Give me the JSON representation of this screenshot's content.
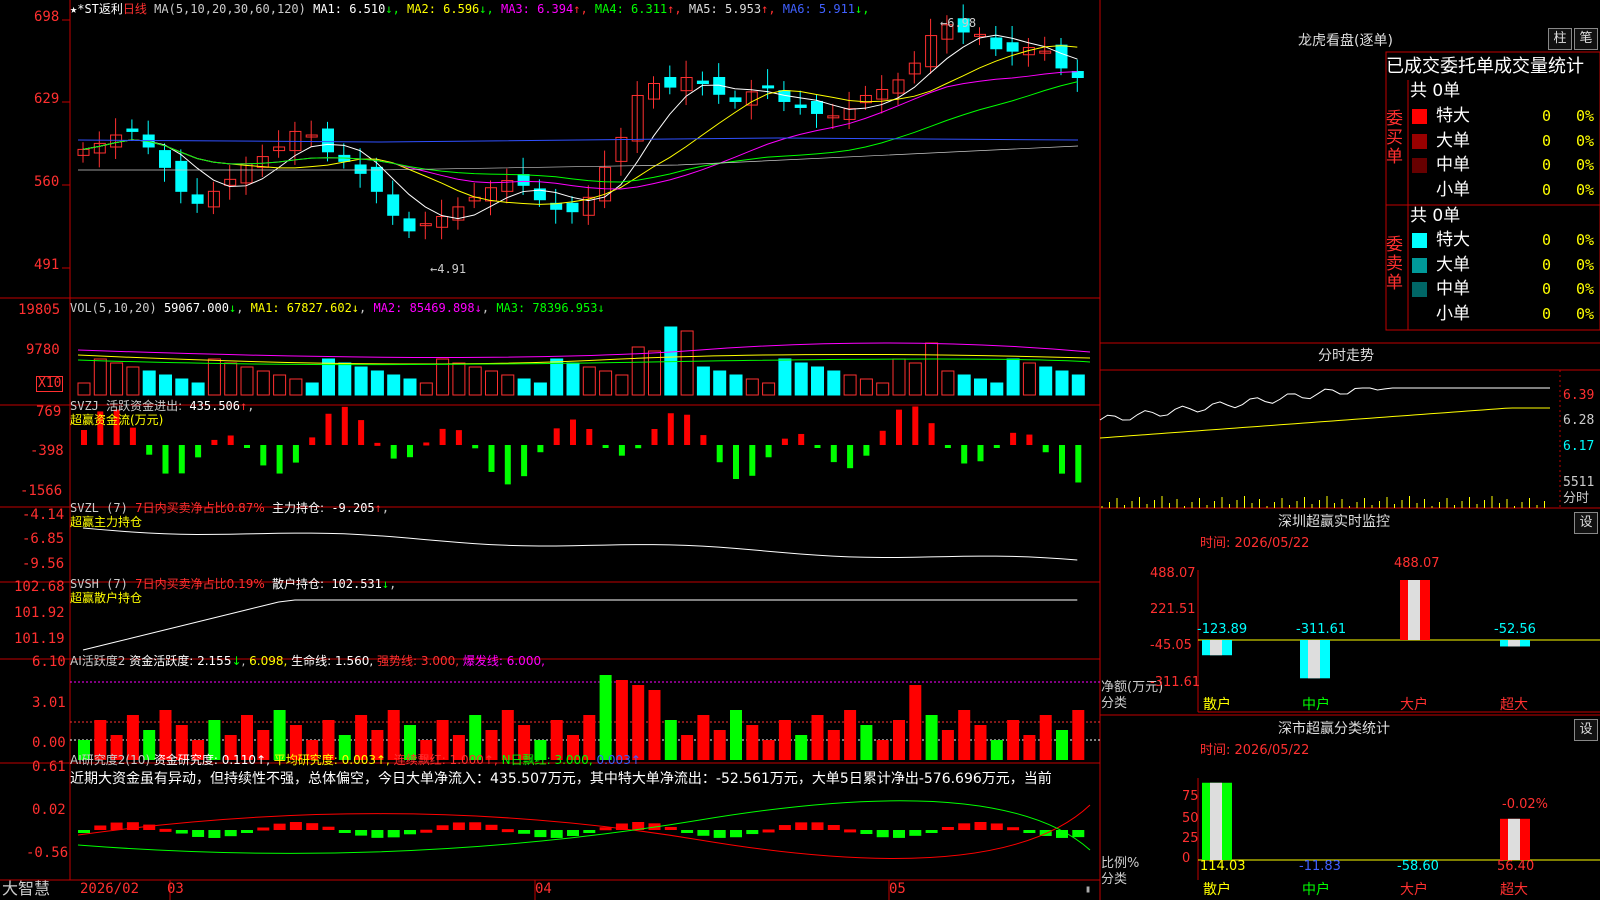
{
  "header": {
    "stock_name": "★*ST返利",
    "period": "日线",
    "ma_label": "MA(5,10,20,30,60,120)",
    "ma_values": [
      {
        "label": "MA1:",
        "value": "6.510",
        "arrow": "↓",
        "color": "#ffffff"
      },
      {
        "label": "MA2:",
        "value": "6.596",
        "arrow": "↓",
        "color": "#ffff00"
      },
      {
        "label": "MA3:",
        "value": "6.394",
        "arrow": "↑",
        "color": "#ff00ff"
      },
      {
        "label": "MA4:",
        "value": "6.311",
        "arrow": "↑",
        "color": "#00ff00"
      },
      {
        "label": "MA5:",
        "value": "5.953",
        "arrow": "↑",
        "color": "#dddddd"
      },
      {
        "label": "MA6:",
        "value": "5.911",
        "arrow": "↓",
        "color": "#4060ff"
      }
    ]
  },
  "price_panel": {
    "y_labels": [
      "698",
      "629",
      "560",
      "491"
    ],
    "high_note": "6.98",
    "low_note": "4.91"
  },
  "vol_panel": {
    "label": "VOL(5,10,20)",
    "vol_value": "59067.000",
    "vol_arrow": "↓",
    "ma1": "MA1: 67827.602↓",
    "ma2": "MA2: 85469.898↓",
    "ma3": "MA3: 78396.953↓",
    "y_labels": [
      "19805",
      "9780"
    ],
    "unit": "X10"
  },
  "svzj_panel": {
    "label": "SVZJ",
    "title": "活跃资金进出:",
    "value": "435.506",
    "arrow": "↑",
    "subtitle": "超赢资金流(万元)",
    "y_labels": [
      "769",
      "-398",
      "-1566"
    ]
  },
  "svzl_panel": {
    "label": "SVZL (7)",
    "ratio": "7日内买卖净占比0.87%",
    "main_label": "主力持仓:",
    "main_value": "-9.205",
    "arrow": "↑",
    "subtitle": "超赢主力持仓",
    "y_labels": [
      "-4.14",
      "-6.85",
      "-9.56"
    ]
  },
  "svsh_panel": {
    "label": "SVSH (7)",
    "ratio": "7日内买卖净占比0.19%",
    "retail_label": "散户持仓:",
    "retail_value": "102.531",
    "arrow": "↓",
    "subtitle": "超赢散户持仓",
    "y_labels": [
      "102.68",
      "101.92",
      "101.19"
    ]
  },
  "ai_active_panel": {
    "label": "AI活跃度2",
    "fund_label": "资金活跃度:",
    "fund_value": "2.155",
    "fund_arrow": "↓",
    "second": "6.098,",
    "life_line": "生命线: 1.560,",
    "strong_line": "强势线: 3.000,",
    "burst_line": "爆发线: 6.000,",
    "y_labels": [
      "6.10",
      "3.01",
      "0.00"
    ]
  },
  "ai_research_panel": {
    "label": "AI研究度2(10)",
    "fund_research": "资金研究度: 0.110↑,",
    "avg_research": "平均研究度: 0.003↑,",
    "cont_red": "连续飘红: 1.000↑,",
    "n_red": "N日飘红: 3.000,",
    "last": "0.003↑",
    "comment": "近期大资金虽有异动，但持续性不强，总体偏空，今日大单净流入：435.507万元，其中特大单净流出：-52.561万元，大单5日累计净出-576.696万元，当前",
    "y_labels": [
      "0.61",
      "0.02",
      "-0.56"
    ]
  },
  "bottom_bar": {
    "brand": "大智慧",
    "dates": [
      "2026/02",
      "03",
      "04",
      "05"
    ]
  },
  "dragon_tiger": {
    "title": "龙虎看盘(逐单)",
    "tab_column": "柱",
    "tab_stroke": "笔",
    "table_title": "已成交委托单成交量统计",
    "buy_side": "委买单",
    "sell_side": "委卖单",
    "buy_total": "共 0单",
    "sell_total": "共 0单",
    "buy_rows": [
      {
        "name": "特大",
        "count": "0",
        "pct": "0%",
        "color": "#ff0000"
      },
      {
        "name": "大单",
        "count": "0",
        "pct": "0%",
        "color": "#990000"
      },
      {
        "name": "中单",
        "count": "0",
        "pct": "0%",
        "color": "#660000"
      },
      {
        "name": "小单",
        "count": "0",
        "pct": "0%",
        "color": ""
      }
    ],
    "sell_rows": [
      {
        "name": "特大",
        "count": "0",
        "pct": "0%",
        "color": "#00ffff"
      },
      {
        "name": "大单",
        "count": "0",
        "pct": "0%",
        "color": "#009999"
      },
      {
        "name": "中单",
        "count": "0",
        "pct": "0%",
        "color": "#006666"
      },
      {
        "name": "小单",
        "count": "0",
        "pct": "0%",
        "color": ""
      }
    ]
  },
  "intraday": {
    "title": "分时走势",
    "y_labels": [
      "6.39",
      "6.28",
      "6.17"
    ],
    "volume": "5511",
    "vol_unit": "分时"
  },
  "sz_monitor": {
    "title": "深圳超赢实时监控",
    "settings": "设",
    "time": "时间: 2026/05/22",
    "y_labels": [
      "488.07",
      "221.51",
      "-45.05",
      "-311.61"
    ],
    "bar_values": [
      "-123.89",
      "-311.61",
      "488.07",
      "-52.56"
    ],
    "categories": [
      "散户",
      "中户",
      "大户",
      "超大"
    ],
    "axis_caption_1": "净额(万元)",
    "axis_caption_2": "分类"
  },
  "sz_class": {
    "title": "深市超赢分类统计",
    "settings": "设",
    "time": "时间: 2026/05/22",
    "y_labels": [
      "75",
      "50",
      "25",
      "0"
    ],
    "top_value": "-0.02%",
    "bar_values": [
      "114.03",
      "-11.83",
      "-58.60",
      "56.40"
    ],
    "categories": [
      "散户",
      "中户",
      "大户",
      "超大"
    ],
    "axis_caption_1": "比例%",
    "axis_caption_2": "分类"
  }
}
